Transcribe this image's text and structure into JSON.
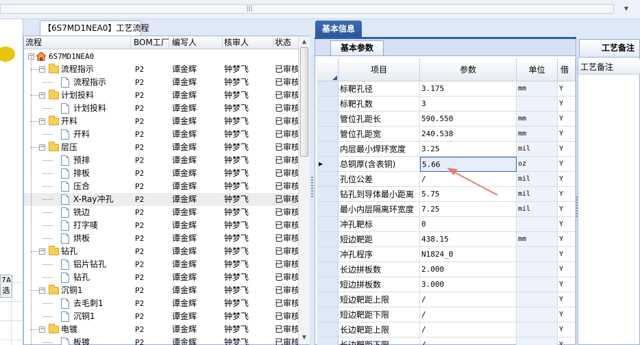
{
  "tree_tab": {
    "title": "【6S7MD1NEA0】工艺流程"
  },
  "left_panel": {
    "button_line1": "7A",
    "button_line2": "选"
  },
  "tree": {
    "columns": [
      "流程",
      "BOM工厂",
      "编写人",
      "核审人",
      "状态"
    ],
    "rows": [
      {
        "level": 0,
        "type": "root",
        "expander": "-",
        "name": "6S7MD1NEA0",
        "bom": "",
        "writer": "",
        "reviewer": "",
        "status": ""
      },
      {
        "level": 1,
        "type": "folder",
        "expander": "-",
        "name": "流程指示",
        "bom": "P2",
        "writer": "谭金辉",
        "reviewer": "钟梦飞",
        "status": "已审核"
      },
      {
        "level": 2,
        "type": "doc",
        "expander": "",
        "name": "流程指示",
        "bom": "P2",
        "writer": "谭金辉",
        "reviewer": "钟梦飞",
        "status": "已审核"
      },
      {
        "level": 1,
        "type": "folder",
        "expander": "-",
        "name": "计划投料",
        "bom": "P2",
        "writer": "谭金辉",
        "reviewer": "钟梦飞",
        "status": "已审核"
      },
      {
        "level": 2,
        "type": "doc",
        "expander": "",
        "name": "计划投料",
        "bom": "P2",
        "writer": "谭金辉",
        "reviewer": "钟梦飞",
        "status": "已审核"
      },
      {
        "level": 1,
        "type": "folder",
        "expander": "-",
        "name": "开料",
        "bom": "P2",
        "writer": "谭金辉",
        "reviewer": "钟梦飞",
        "status": "已审核"
      },
      {
        "level": 2,
        "type": "doc",
        "expander": "",
        "name": "开料",
        "bom": "P2",
        "writer": "谭金辉",
        "reviewer": "钟梦飞",
        "status": "已审核"
      },
      {
        "level": 1,
        "type": "folder",
        "expander": "-",
        "name": "层压",
        "bom": "P2",
        "writer": "谭金辉",
        "reviewer": "钟梦飞",
        "status": "已审核"
      },
      {
        "level": 2,
        "type": "doc",
        "expander": "",
        "name": "预排",
        "bom": "P2",
        "writer": "谭金辉",
        "reviewer": "钟梦飞",
        "status": "已审核"
      },
      {
        "level": 2,
        "type": "doc",
        "expander": "",
        "name": "排板",
        "bom": "P2",
        "writer": "谭金辉",
        "reviewer": "钟梦飞",
        "status": "已审核"
      },
      {
        "level": 2,
        "type": "doc",
        "expander": "",
        "name": "压合",
        "bom": "P2",
        "writer": "谭金辉",
        "reviewer": "钟梦飞",
        "status": "已审核"
      },
      {
        "level": 2,
        "type": "doc",
        "expander": "",
        "name": "X-Ray冲孔",
        "bom": "P2",
        "writer": "谭金辉",
        "reviewer": "钟梦飞",
        "status": "已审核",
        "selected": true
      },
      {
        "level": 2,
        "type": "doc",
        "expander": "",
        "name": "铣边",
        "bom": "P2",
        "writer": "谭金辉",
        "reviewer": "钟梦飞",
        "status": "已审核"
      },
      {
        "level": 2,
        "type": "doc",
        "expander": "",
        "name": "打字唛",
        "bom": "P2",
        "writer": "谭金辉",
        "reviewer": "钟梦飞",
        "status": "已审核"
      },
      {
        "level": 2,
        "type": "doc",
        "expander": "",
        "name": "烘板",
        "bom": "P2",
        "writer": "谭金辉",
        "reviewer": "钟梦飞",
        "status": "已审核"
      },
      {
        "level": 1,
        "type": "folder",
        "expander": "-",
        "name": "钻孔",
        "bom": "P2",
        "writer": "谭金辉",
        "reviewer": "钟梦飞",
        "status": "已审核"
      },
      {
        "level": 2,
        "type": "doc",
        "expander": "",
        "name": "铝片钻孔",
        "bom": "P2",
        "writer": "谭金辉",
        "reviewer": "钟梦飞",
        "status": "已审核"
      },
      {
        "level": 2,
        "type": "doc",
        "expander": "",
        "name": "钻孔",
        "bom": "P2",
        "writer": "谭金辉",
        "reviewer": "钟梦飞",
        "status": "已审核"
      },
      {
        "level": 1,
        "type": "folder",
        "expander": "-",
        "name": "沉铜1",
        "bom": "P2",
        "writer": "谭金辉",
        "reviewer": "钟梦飞",
        "status": "已审核"
      },
      {
        "level": 2,
        "type": "doc",
        "expander": "",
        "name": "去毛刺1",
        "bom": "P2",
        "writer": "谭金辉",
        "reviewer": "钟梦飞",
        "status": "已审核"
      },
      {
        "level": 2,
        "type": "doc",
        "expander": "",
        "name": "沉铜1",
        "bom": "P2",
        "writer": "谭金辉",
        "reviewer": "钟梦飞",
        "status": "已审核"
      },
      {
        "level": 1,
        "type": "folder",
        "expander": "-",
        "name": "电镀",
        "bom": "P2",
        "writer": "谭金辉",
        "reviewer": "钟梦飞",
        "status": "已审核"
      },
      {
        "level": 2,
        "type": "doc",
        "expander": "",
        "name": "板镀",
        "bom": "P2",
        "writer": "谭金辉",
        "reviewer": "钟梦飞",
        "status": "已审核"
      }
    ]
  },
  "right": {
    "top_tab": "基本信息",
    "sub_tab": "基本参数",
    "columns": [
      "项目",
      "参数",
      "单位",
      "借"
    ],
    "rows": [
      {
        "name": "标靶孔径",
        "value": "3.175",
        "unit": "mm",
        "flag": "Y"
      },
      {
        "name": "标靶孔数",
        "value": "3",
        "unit": "",
        "flag": "Y"
      },
      {
        "name": "管位孔距长",
        "value": "590.550",
        "unit": "mm",
        "flag": "Y"
      },
      {
        "name": "管位孔距宽",
        "value": "240.538",
        "unit": "mm",
        "flag": "Y"
      },
      {
        "name": "内层最小焊环宽度",
        "value": "3.25",
        "unit": "mil",
        "flag": "Y"
      },
      {
        "name": "总铜厚(含表铜)",
        "value": "5.66",
        "unit": "oz",
        "flag": "Y",
        "current": true,
        "editing": true
      },
      {
        "name": "孔位公差",
        "value": "/",
        "unit": "mil",
        "flag": "Y"
      },
      {
        "name": "钻孔到导体最小距离",
        "value": "5.75",
        "unit": "mil",
        "flag": "Y"
      },
      {
        "name": "最小内层隔离环宽度",
        "value": "7.25",
        "unit": "mil",
        "flag": "Y"
      },
      {
        "name": "冲孔靶标",
        "value": "0",
        "unit": "",
        "flag": "Y"
      },
      {
        "name": "短边靶距",
        "value": "438.15",
        "unit": "mm",
        "flag": "Y"
      },
      {
        "name": "冲孔程序",
        "value": "N1824_0",
        "unit": "",
        "flag": "Y"
      },
      {
        "name": "长边拼板数",
        "value": "2.000",
        "unit": "",
        "flag": "Y"
      },
      {
        "name": "短边拼板数",
        "value": "3.000",
        "unit": "",
        "flag": "Y"
      },
      {
        "name": "短边靶距上限",
        "value": "/",
        "unit": "",
        "flag": "Y"
      },
      {
        "name": "短边靶距下限",
        "value": "/",
        "unit": "",
        "flag": "Y"
      },
      {
        "name": "长边靶距上限",
        "value": "/",
        "unit": "",
        "flag": "Y"
      },
      {
        "name": "长边靶距下限",
        "value": "/",
        "unit": "",
        "flag": "Y"
      }
    ]
  },
  "remarks": {
    "tab": "工艺备注",
    "header": "工艺备注"
  },
  "colors": {
    "accent_tab": "#2e5ea4",
    "annotation_arrow": "#e87a7a"
  }
}
